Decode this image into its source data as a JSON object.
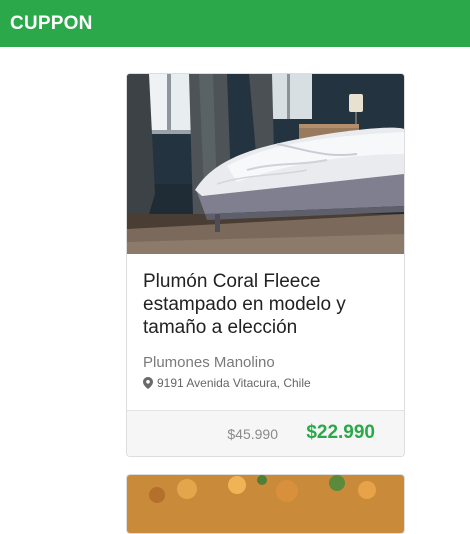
{
  "header": {
    "brand": "CUPPON",
    "background_color": "#2ba84a"
  },
  "deals": [
    {
      "image_subject": "bed with white duvet",
      "title": "Plumón Coral Fleece estampado en modelo y tamaño a elección",
      "merchant": "Plumones Manolino",
      "address_icon": "map-marker-icon",
      "address": "9191 Avenida Vitacura, Chile",
      "original_price": "$45.990",
      "sale_price": "$22.990",
      "sale_price_color": "#2ba84a"
    },
    {
      "image_subject": "food dish (partially visible)"
    }
  ]
}
